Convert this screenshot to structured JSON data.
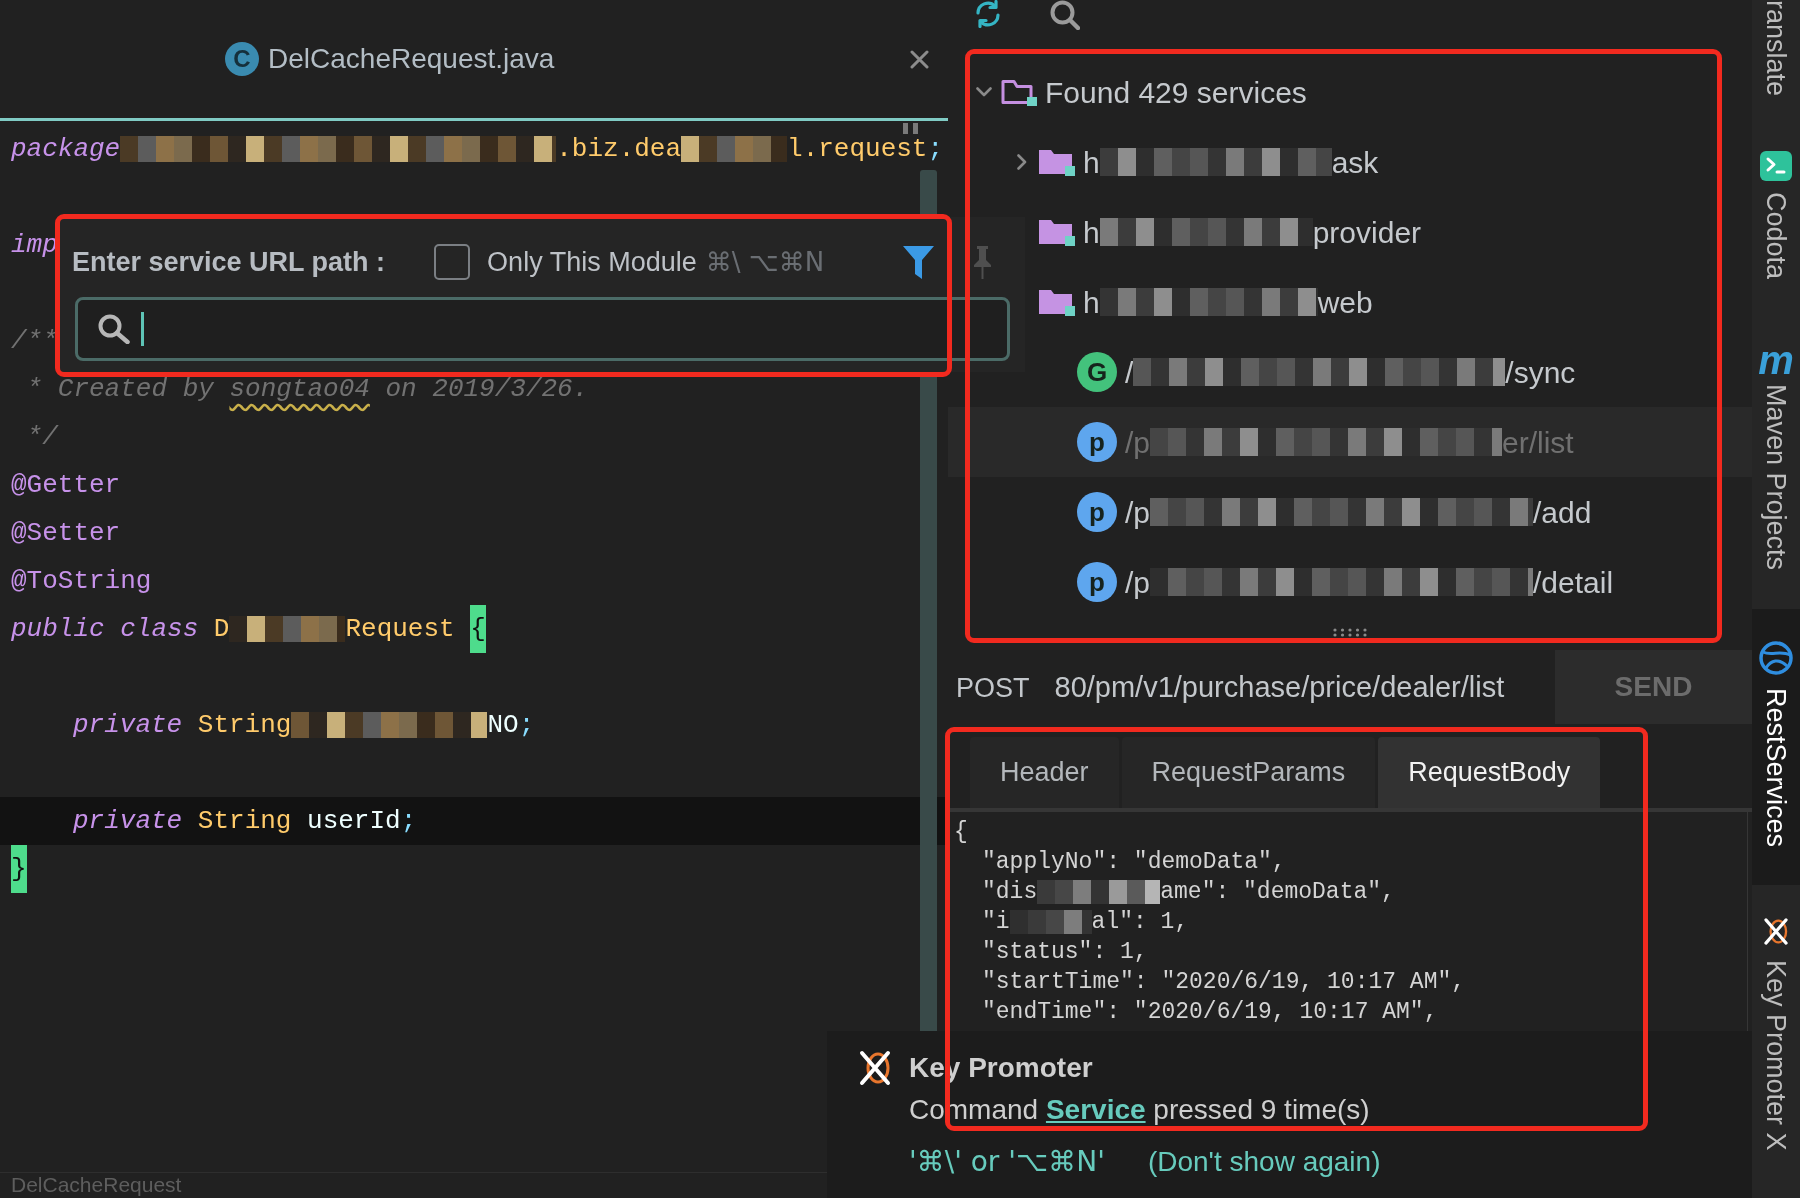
{
  "editor": {
    "tab": {
      "icon_letter": "C",
      "title": "DelCacheRequest.java",
      "selected": true
    },
    "lines": [
      {
        "kind": "code",
        "current": false,
        "indented": false,
        "segments": [
          {
            "kind": "keyword",
            "text": "package"
          },
          {
            "kind": "redacted"
          },
          {
            "kind": "type",
            "text": ".biz.dea"
          },
          {
            "kind": "redacted"
          },
          {
            "kind": "type",
            "text": "l.request"
          },
          {
            "kind": "punct",
            "text": ";"
          }
        ]
      },
      {
        "kind": "blank",
        "current": false
      },
      {
        "kind": "code",
        "current": false,
        "indented": false,
        "segments": [
          {
            "kind": "keyword",
            "text": "imp"
          }
        ]
      },
      {
        "kind": "blank",
        "current": false
      },
      {
        "kind": "code",
        "current": false,
        "indented": false,
        "segments": [
          {
            "kind": "comment",
            "text": "/**"
          }
        ]
      },
      {
        "kind": "code",
        "current": false,
        "indented": false,
        "segments": [
          {
            "kind": "comment",
            "text": " * Created by "
          },
          {
            "kind": "typo",
            "text": "songtao04"
          },
          {
            "kind": "comment",
            "text": " on 2019/3/26."
          }
        ]
      },
      {
        "kind": "code",
        "current": false,
        "indented": false,
        "segments": [
          {
            "kind": "comment",
            "text": " */"
          }
        ]
      },
      {
        "kind": "code",
        "current": false,
        "indented": false,
        "segments": [
          {
            "kind": "annotation",
            "text": "@Getter"
          }
        ]
      },
      {
        "kind": "code",
        "current": false,
        "indented": false,
        "segments": [
          {
            "kind": "annotation",
            "text": "@Setter"
          }
        ]
      },
      {
        "kind": "code",
        "current": false,
        "indented": false,
        "segments": [
          {
            "kind": "annotation",
            "text": "@ToString"
          }
        ]
      },
      {
        "kind": "code",
        "current": false,
        "indented": false,
        "segments": [
          {
            "kind": "keyword",
            "text": "public class"
          },
          {
            "kind": "space"
          },
          {
            "kind": "type",
            "text": "D"
          },
          {
            "kind": "redacted"
          },
          {
            "kind": "type",
            "text": "Request"
          },
          {
            "kind": "space"
          },
          {
            "kind": "brace",
            "text": "{"
          }
        ]
      },
      {
        "kind": "blank",
        "current": false
      },
      {
        "kind": "code",
        "current": false,
        "indented": true,
        "segments": [
          {
            "kind": "keyword",
            "text": "private"
          },
          {
            "kind": "space"
          },
          {
            "kind": "type",
            "text": "String"
          },
          {
            "kind": "redacted"
          },
          {
            "kind": "plain",
            "text": "NO"
          },
          {
            "kind": "punct",
            "text": ";"
          }
        ]
      },
      {
        "kind": "blank",
        "current": false
      },
      {
        "kind": "code",
        "current": true,
        "indented": true,
        "segments": [
          {
            "kind": "keyword",
            "text": "private"
          },
          {
            "kind": "type",
            "text": " String"
          },
          {
            "kind": "plain",
            "text": " userId"
          },
          {
            "kind": "punct",
            "text": ";"
          }
        ]
      },
      {
        "kind": "code",
        "current": false,
        "indented": false,
        "segments": [
          {
            "kind": "brace",
            "text": "}"
          }
        ]
      }
    ],
    "breadcrumb": "DelCacheRequest"
  },
  "url_popup": {
    "label": "Enter service URL path :",
    "module_filter": {
      "label": "Only This Module",
      "shortcut": "⌘\\ ⌥⌘N",
      "checked": false
    },
    "search": {
      "focused": true
    }
  },
  "rest_services": {
    "tree": {
      "kind": "root",
      "label": "Found 429 services",
      "expanded": true,
      "selected": false,
      "children": [
        {
          "kind": "module",
          "label_start": "h",
          "label_end": "ask",
          "expanded": false,
          "selected": false
        },
        {
          "kind": "module",
          "label_start": "h",
          "label_end": "provider",
          "selected": false
        },
        {
          "kind": "module",
          "label_start": "h",
          "label_end": "web",
          "selected": false,
          "children": [
            {
              "kind": "service",
              "badge": "G",
              "color": "#43c27c",
              "label_start": "/",
              "label_end": "/sync",
              "selected": false
            },
            {
              "kind": "service",
              "badge": "p",
              "color": "#5ea6ee",
              "label_start": "/p",
              "label_end": "er/list",
              "selected": true
            },
            {
              "kind": "service",
              "badge": "p",
              "color": "#5ea6ee",
              "label_start": "/p",
              "label_end": "/add",
              "selected": false
            },
            {
              "kind": "service",
              "badge": "p",
              "color": "#5ea6ee",
              "label_start": "/p",
              "label_end": "/detail",
              "selected": false
            }
          ]
        }
      ]
    },
    "request": {
      "method": "POST",
      "url": "80/pm/v1/purchase/price/dealer/list",
      "send": "SEND"
    },
    "tabs": [
      {
        "label": "Header",
        "selected": false
      },
      {
        "label": "RequestParams",
        "selected": false
      },
      {
        "label": "RequestBody",
        "selected": true
      }
    ],
    "body_lines": [
      {
        "indented": false,
        "segments": [
          {
            "kind": "text",
            "text": "{"
          }
        ]
      },
      {
        "indented": true,
        "segments": [
          {
            "kind": "text",
            "text": "\"applyNo\": \"demoData\","
          }
        ]
      },
      {
        "indented": true,
        "segments": [
          {
            "kind": "text",
            "text": "\"dis"
          },
          {
            "kind": "redacted"
          },
          {
            "kind": "text",
            "text": "ame\": \"demoData\","
          }
        ]
      },
      {
        "indented": true,
        "segments": [
          {
            "kind": "text",
            "text": "\"i"
          },
          {
            "kind": "redacted"
          },
          {
            "kind": "text",
            "text": "al\": 1,"
          }
        ]
      },
      {
        "indented": true,
        "segments": [
          {
            "kind": "text",
            "text": "\"status\": 1,"
          }
        ]
      },
      {
        "indented": true,
        "segments": [
          {
            "kind": "text",
            "text": "\"startTime\": \"2020/6/19, 10:17 AM\","
          }
        ]
      },
      {
        "indented": true,
        "segments": [
          {
            "kind": "text",
            "text": "\"endTime\": \"2020/6/19, 10:17 AM\","
          }
        ]
      }
    ]
  },
  "notification": {
    "title": "Key Promoter",
    "message": {
      "before": "Command ",
      "link": "Service",
      "after": " pressed 9 time(s)"
    },
    "shortcut": "'⌘\\' or '⌥⌘N'",
    "dismiss": "(Don't show again)"
  },
  "side_tabs": [
    {
      "kind": "plain",
      "label": "ranslate",
      "selected": false
    },
    {
      "kind": "terminal",
      "label": "Codota",
      "selected": false
    },
    {
      "kind": "glyph",
      "glyph": "m",
      "label": "Maven Projects",
      "selected": false
    },
    {
      "kind": "globe",
      "label": "RestServices",
      "selected": true
    },
    {
      "kind": "cross",
      "label": "Key Promoter X",
      "selected": false
    }
  ]
}
